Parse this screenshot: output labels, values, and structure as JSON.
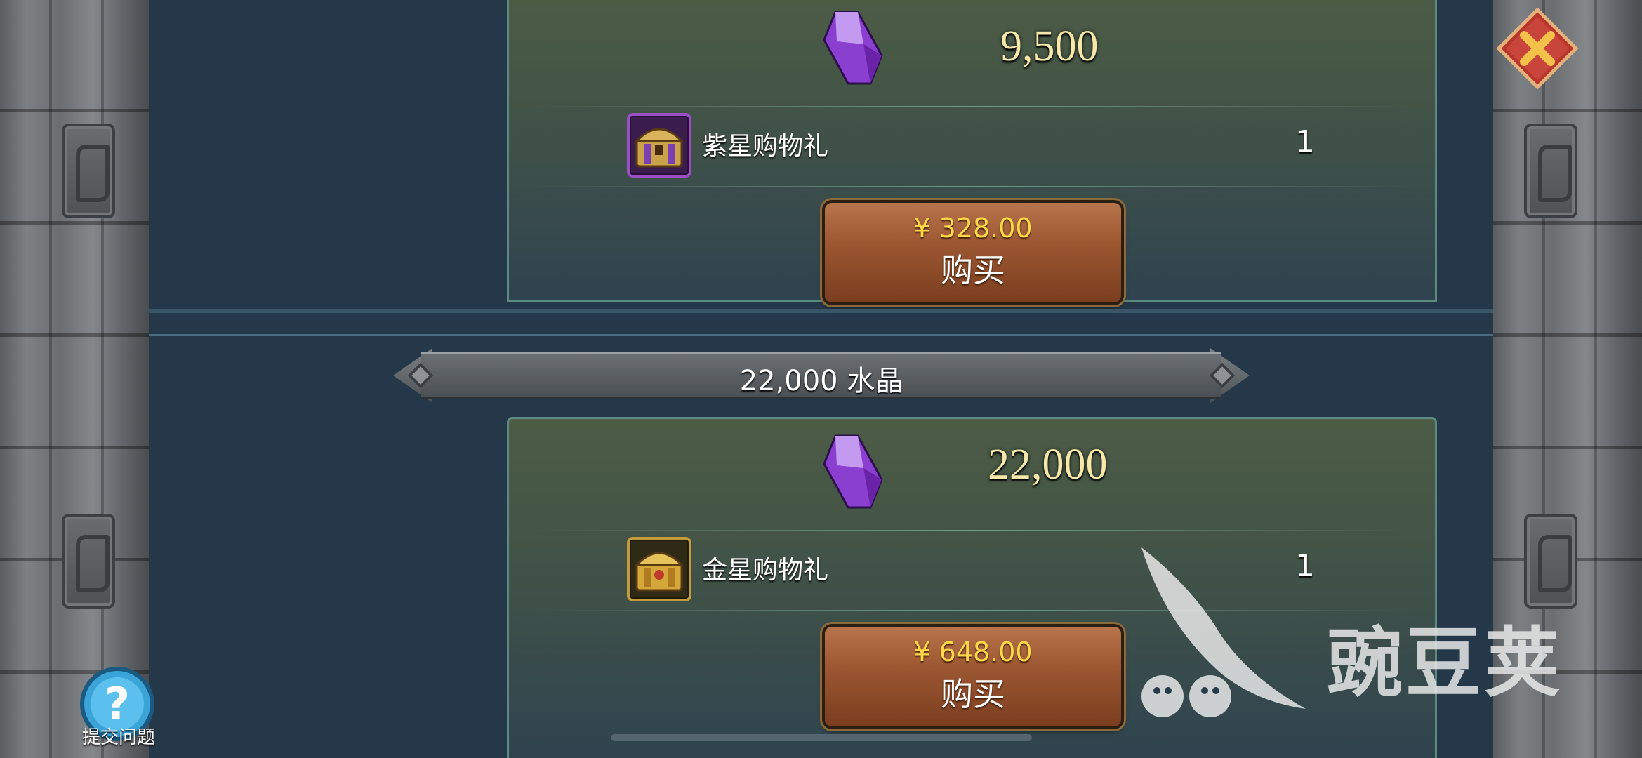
{
  "offers": [
    {
      "crystal_amount": "9,500",
      "item_name": "紫星购物礼",
      "item_qty": "1",
      "price": "¥ 328.00",
      "buy_label": "购买"
    },
    {
      "crystal_amount": "22,000",
      "item_name": "金星购物礼",
      "item_qty": "1",
      "price": "¥ 648.00",
      "buy_label": "购买"
    }
  ],
  "tier_banner": "22,000 水晶",
  "help": {
    "label": "提交问题"
  },
  "watermark": {
    "text": "豌豆荚"
  },
  "icons": {
    "close": "close-icon",
    "help": "question-icon",
    "crystal": "purple-crystal-icon",
    "purple_chest": "purple-treasure-chest-icon",
    "gold_chest": "gold-treasure-chest-icon"
  },
  "colors": {
    "amount_text": "#f7e7a8",
    "price_text": "#ffd84a",
    "button": "#9a5530",
    "panel": "#4d5c45",
    "close": "#c0392b"
  }
}
